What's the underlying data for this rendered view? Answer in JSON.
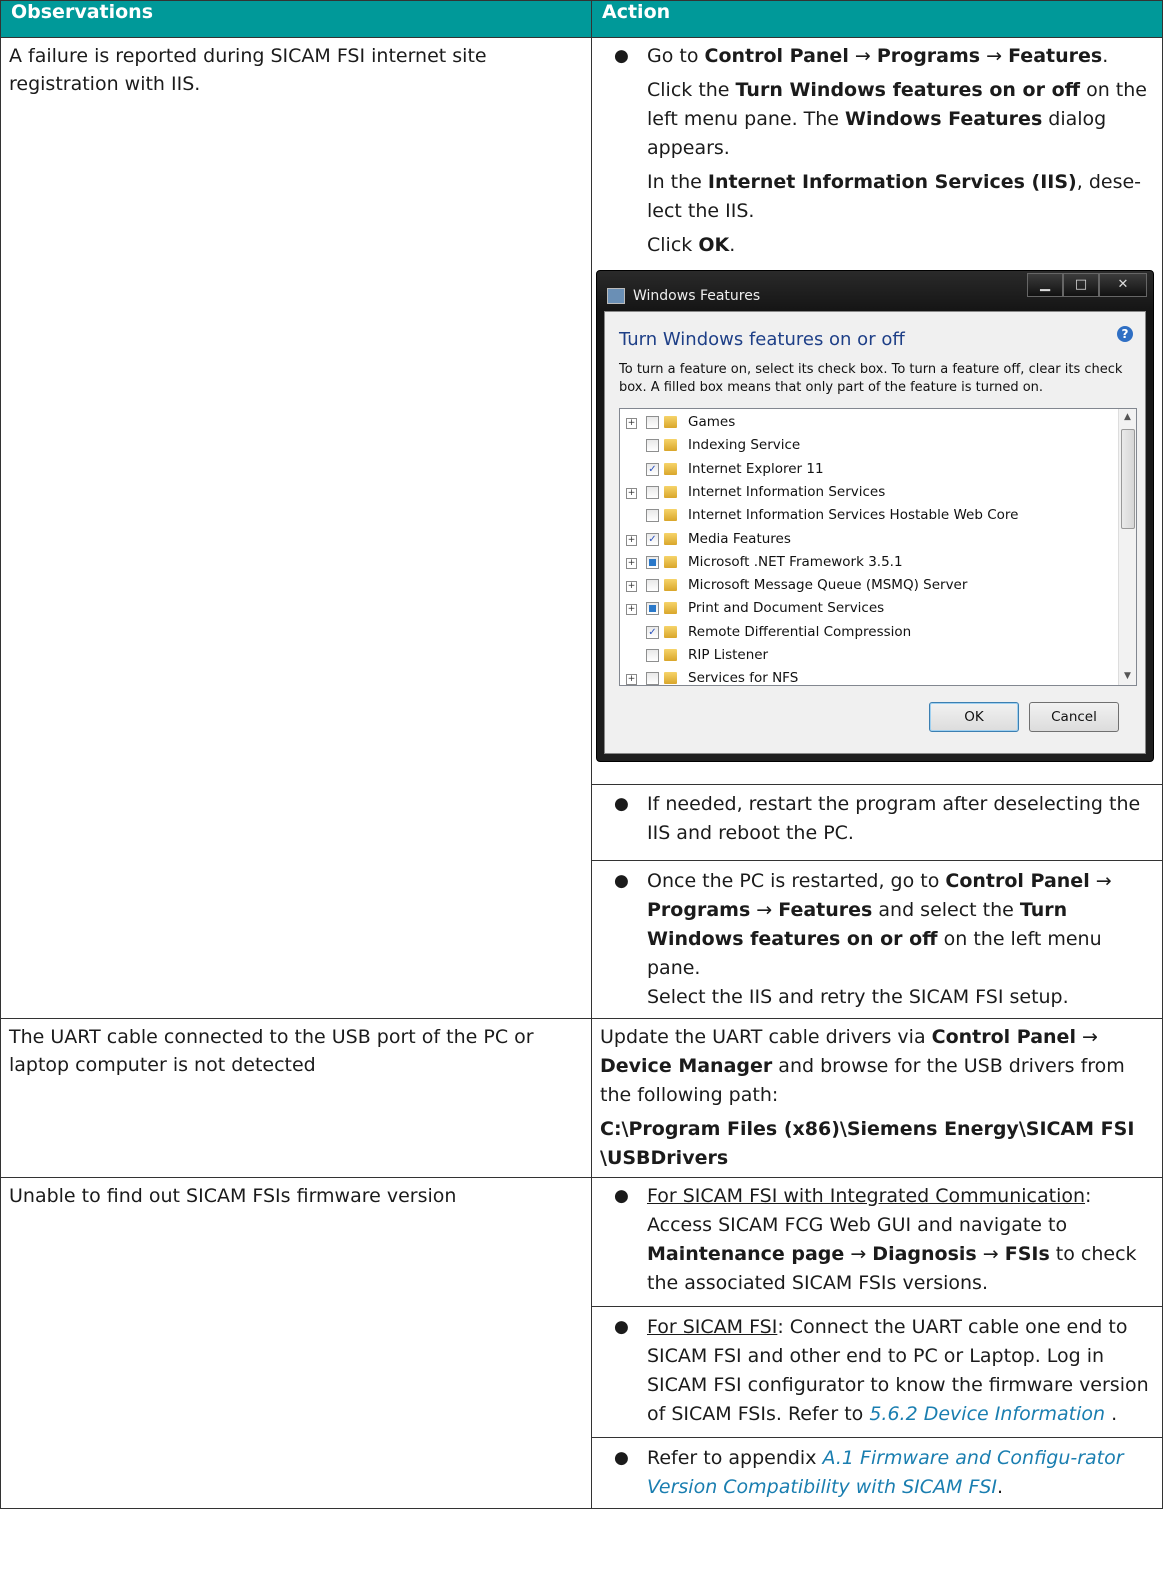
{
  "header": {
    "col1": "Observations",
    "col2": "Action"
  },
  "rows": {
    "r1": {
      "obs": "A failure is reported during SICAM FSI internet site registration with IIS.",
      "b1": {
        "t1": "Go to ",
        "cp": "Control Panel",
        "arr1": " → ",
        "prog": "Programs",
        "arr2": " → ",
        "feat": "Features",
        "dot": ".",
        "l2a": "Click the ",
        "l2b": "Turn Windows features on or off",
        "l2c": " on the left menu pane. The ",
        "l2d": "Windows Features",
        "l2e": " dialog appears.",
        "l3a": "In the ",
        "l3b": "Internet Information Services (IIS)",
        "l3c": ", dese-lect the IIS.",
        "l4a": "Click ",
        "l4b": "OK",
        "l4c": "."
      },
      "dialog": {
        "title": "Windows Features",
        "heading": "Turn Windows features on or off",
        "description": "To turn a feature on, select its check box. To turn a feature off, clear its check box. A filled box means that only part of the feature is turned on.",
        "items": [
          {
            "label": "Games",
            "expandable": true,
            "state": "unchecked"
          },
          {
            "label": "Indexing Service",
            "expandable": false,
            "state": "unchecked"
          },
          {
            "label": "Internet Explorer 11",
            "expandable": false,
            "state": "checked"
          },
          {
            "label": "Internet Information Services",
            "expandable": true,
            "state": "unchecked"
          },
          {
            "label": "Internet Information Services Hostable Web Core",
            "expandable": false,
            "state": "unchecked"
          },
          {
            "label": "Media Features",
            "expandable": true,
            "state": "checked"
          },
          {
            "label": "Microsoft .NET Framework 3.5.1",
            "expandable": true,
            "state": "partial"
          },
          {
            "label": "Microsoft Message Queue (MSMQ) Server",
            "expandable": true,
            "state": "unchecked"
          },
          {
            "label": "Print and Document Services",
            "expandable": true,
            "state": "partial"
          },
          {
            "label": "Remote Differential Compression",
            "expandable": false,
            "state": "checked"
          },
          {
            "label": "RIP Listener",
            "expandable": false,
            "state": "unchecked"
          },
          {
            "label": "Services for NFS",
            "expandable": true,
            "state": "unchecked"
          }
        ],
        "ok": "OK",
        "cancel": "Cancel"
      },
      "b2": "If needed, restart the program after deselecting the IIS and reboot the PC.",
      "b3": {
        "a": "Once the PC is restarted, go to ",
        "b": "Control Panel",
        "c": " → ",
        "d": "Programs",
        "e": " → ",
        "f": "Features",
        "g": " and select the ",
        "h": "Turn Windows features on or off",
        "i": " on the left menu pane.",
        "j": "Select the IIS and retry the SICAM FSI setup."
      }
    },
    "r2": {
      "obs": "The UART cable connected to the USB port of the PC or laptop computer is not detected",
      "a": "Update the UART cable drivers via ",
      "b": "Control Panel",
      "c": " → ",
      "d": "Device Manager",
      "e": " and browse for the USB drivers from the following path:",
      "path": "C:\\Program Files (x86)\\Siemens Energy\\SICAM FSI \\USBDrivers"
    },
    "r3": {
      "obs": "Unable to find out SICAM FSIs firmware version",
      "b1": {
        "u": "For SICAM FSI with Integrated Communication",
        "a": ": Access SICAM FCG Web GUI and navigate to ",
        "b": "Maintenance page",
        "c": " → ",
        "d": "Diagnosis",
        "e": " → ",
        "f": "FSIs",
        "g": " to check the associated SICAM FSIs versions."
      },
      "b2": {
        "u": "For SICAM FSI",
        "a": ": Connect the UART cable one end to SICAM FSI and other end to PC or Laptop. Log in SICAM FSI configurator to know the firmware version of SICAM FSIs. Refer to ",
        "link": "5.6.2 Device Information",
        "b": " ."
      },
      "b3": {
        "a": "Refer to appendix ",
        "link": "A.1 Firmware and Configu-rator Version Compatibility with SICAM FSI",
        "b": "."
      }
    }
  }
}
